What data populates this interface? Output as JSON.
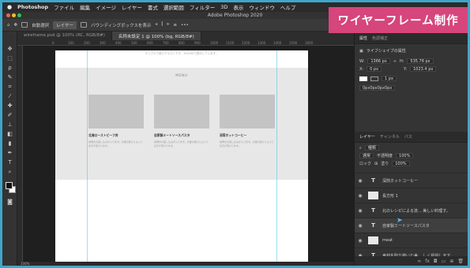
{
  "menubar": {
    "app": "Photoshop",
    "items": [
      "ファイル",
      "編集",
      "イメージ",
      "レイヤー",
      "書式",
      "選択範囲",
      "フィルター",
      "3D",
      "表示",
      "ウィンドウ",
      "ヘルプ"
    ]
  },
  "window": {
    "title": "Adobe Photoshop 2020"
  },
  "options": {
    "auto_select": "自動選択",
    "layer_select": "レイヤー",
    "bbox": "バウンディングボックスを表示"
  },
  "banner": {
    "text": "ワイヤーフレーム制作"
  },
  "tabs": [
    {
      "label": "wireframe.psd @ 100% (RC, RGB/8#)"
    },
    {
      "label": "名称未設定 1 @ 100% (bg, RGB/8#)"
    }
  ],
  "ruler": {
    "ticks": [
      "0",
      "100",
      "200",
      "300",
      "400",
      "500",
      "600",
      "700",
      "800",
      "900",
      "1000",
      "1100",
      "1200",
      "1300",
      "1400",
      "1500",
      "1600"
    ]
  },
  "artboard": {
    "header_text": "サンプルで使うテキストです。100x90で表示しています。",
    "menu_title": "MENU",
    "cards": [
      {
        "title": "北海ローストビーフ丼",
        "desc": "説明文の差し込みが入ります。文章の長さによって表示が変わります。"
      },
      {
        "title": "自家製ミートソースパスタ",
        "desc": "説明文の差し込みが入ります。文章の長さによって表示が変わります。"
      },
      {
        "title": "深煎ホットコーヒー",
        "desc": "説明文の差し込みが入ります。文章の長さによって表示が変わります。"
      }
    ]
  },
  "status": {
    "zoom": "100%"
  },
  "properties": {
    "tabs": [
      "属性",
      "色調補正"
    ],
    "kind": "ライブシェイプの属性",
    "w": "1366 px",
    "h": "535.78 px",
    "x": "0 px",
    "y": "1023.4 px",
    "stroke": "1 px",
    "radius": "0px0px0px0px"
  },
  "layers_panel": {
    "tabs": [
      "レイヤー",
      "チャンネル",
      "パス"
    ],
    "kind_filter": "種類",
    "blend": "通常",
    "opacity_label": "不透明度",
    "opacity": "100%",
    "lock_label": "ロック",
    "fill_label": "塗り",
    "fill": "100%",
    "layers": [
      {
        "name": "深煎ホットコーヒー",
        "type": "T"
      },
      {
        "name": "長方形 1",
        "type": "img"
      },
      {
        "name": "北のレシピによる流... 美しい料理す。",
        "type": "T"
      },
      {
        "name": "自家製ミートソースパスタ",
        "type": "T"
      },
      {
        "name": "meat",
        "type": "img"
      },
      {
        "name": "食材を取り揃いた美... しく提供します。",
        "type": "T"
      }
    ]
  }
}
